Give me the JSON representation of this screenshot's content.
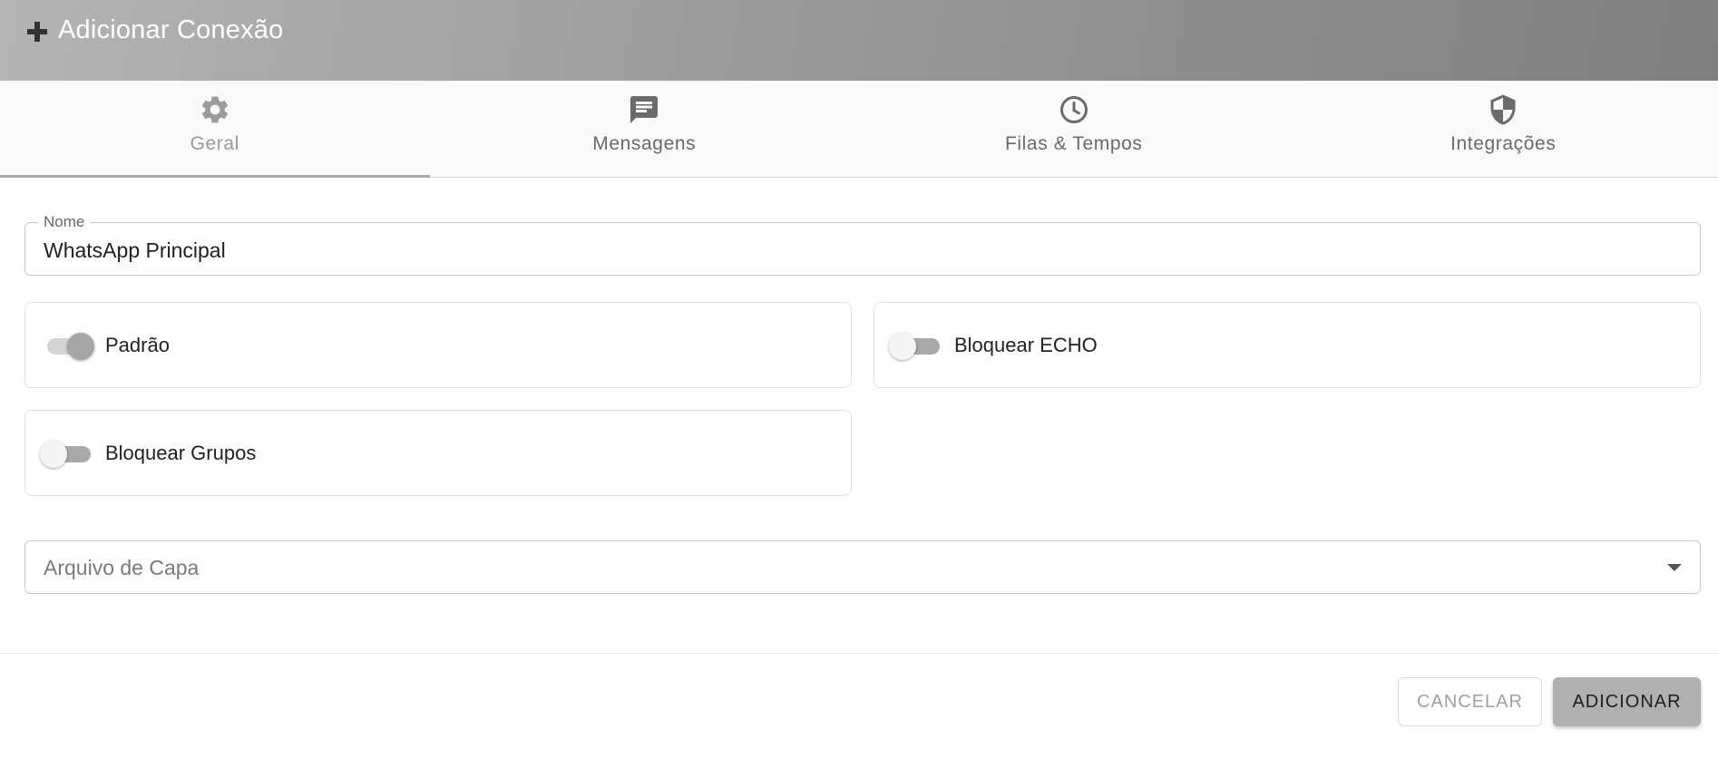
{
  "dialog": {
    "title": "Adicionar Conexão"
  },
  "tabs": [
    {
      "label": "Geral",
      "icon": "gear-icon",
      "active": true
    },
    {
      "label": "Mensagens",
      "icon": "message-icon",
      "active": false
    },
    {
      "label": "Filas & Tempos",
      "icon": "clock-icon",
      "active": false
    },
    {
      "label": "Integrações",
      "icon": "shield-icon",
      "active": false
    }
  ],
  "form": {
    "name_label": "Nome",
    "name_value": "WhatsApp Principal",
    "toggles": {
      "padrao": {
        "label": "Padrão",
        "on": true
      },
      "bloquear_echo": {
        "label": "Bloquear ECHO",
        "on": false
      },
      "bloquear_grupos": {
        "label": "Bloquear Grupos",
        "on": false
      }
    },
    "cover_file_placeholder": "Arquivo de Capa"
  },
  "actions": {
    "cancel_label": "CANCELAR",
    "add_label": "ADICIONAR"
  },
  "colors": {
    "header_gradient_start": "#b4b4b4",
    "header_gradient_end": "#7f7f7f",
    "tab_indicator": "#aaaaaa",
    "primary_button": "#b0b0b0"
  }
}
